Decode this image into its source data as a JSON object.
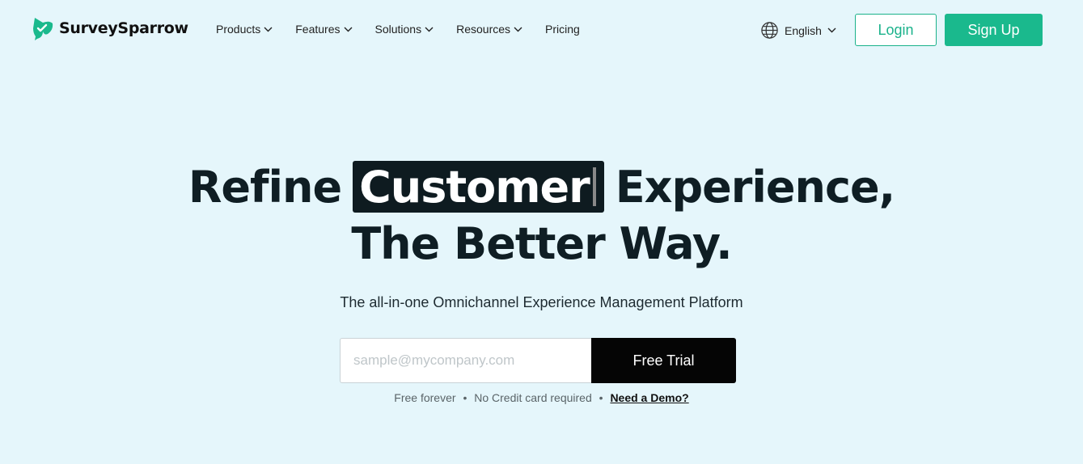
{
  "header": {
    "brand": "SurveySparrow",
    "nav": [
      {
        "label": "Products"
      },
      {
        "label": "Features"
      },
      {
        "label": "Solutions"
      },
      {
        "label": "Resources"
      },
      {
        "label": "Pricing"
      }
    ],
    "language": "English",
    "login_label": "Login",
    "signup_label": "Sign Up"
  },
  "hero": {
    "line1_before": "Refine",
    "highlight": "Customer",
    "line1_after": "Experience,",
    "line2": "The Better Way.",
    "subtitle": "The all-in-one Omnichannel Experience Management Platform"
  },
  "form": {
    "email_placeholder": "sample@mycompany.com",
    "email_value": "",
    "button_label": "Free Trial"
  },
  "note": {
    "item1": "Free forever",
    "item2": "No Credit card required",
    "separator": "•",
    "demo_link": "Need a Demo?"
  },
  "colors": {
    "background": "#e5f6fb",
    "accent": "#1ab98d",
    "dark": "#0e1b20"
  },
  "icons": {
    "logo": "sparrow-logo-icon",
    "globe": "globe-icon",
    "chevron": "chevron-down-icon"
  }
}
